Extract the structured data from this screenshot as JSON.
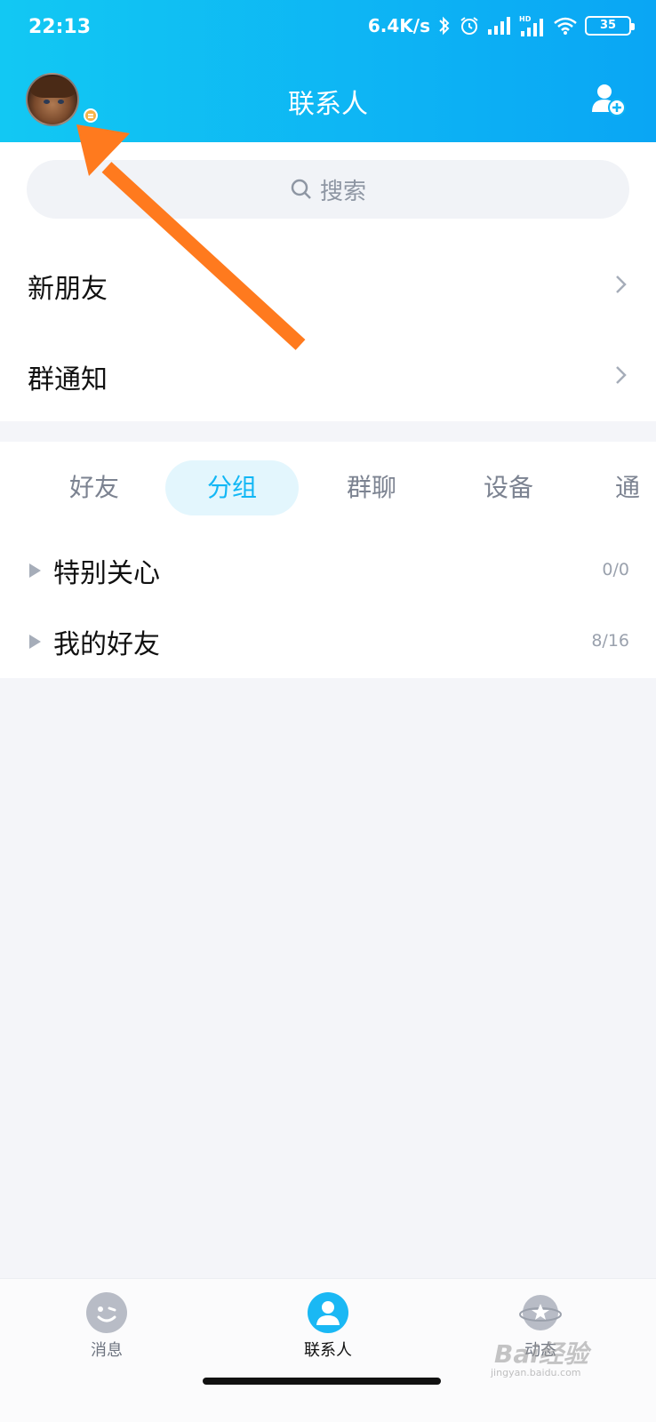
{
  "status_bar": {
    "time": "22:13",
    "net_speed": "6.4K/s",
    "battery": "35",
    "hd": "HD"
  },
  "header": {
    "title": "联系人"
  },
  "search": {
    "placeholder": "搜索"
  },
  "entries": [
    {
      "label": "新朋友"
    },
    {
      "label": "群通知"
    }
  ],
  "tabs": [
    {
      "label": "好友",
      "active": false
    },
    {
      "label": "分组",
      "active": true
    },
    {
      "label": "群聊",
      "active": false
    },
    {
      "label": "设备",
      "active": false
    },
    {
      "label": "通",
      "active": false
    }
  ],
  "groups": [
    {
      "name": "特别关心",
      "count": "0/0"
    },
    {
      "name": "我的好友",
      "count": "8/16"
    }
  ],
  "bottom_nav": [
    {
      "label": "消息",
      "icon": "chat-bubble-icon",
      "active": false
    },
    {
      "label": "联系人",
      "icon": "contacts-person-icon",
      "active": true
    },
    {
      "label": "动态",
      "icon": "planet-star-icon",
      "active": false
    }
  ],
  "watermark": {
    "brand": "Bai经验",
    "url": "jingyan.baidu.com"
  },
  "colors": {
    "accent": "#12b7f5",
    "header_start": "#12c8f3",
    "header_end": "#0aa6f4",
    "annotation_arrow": "#ff7a1e"
  }
}
